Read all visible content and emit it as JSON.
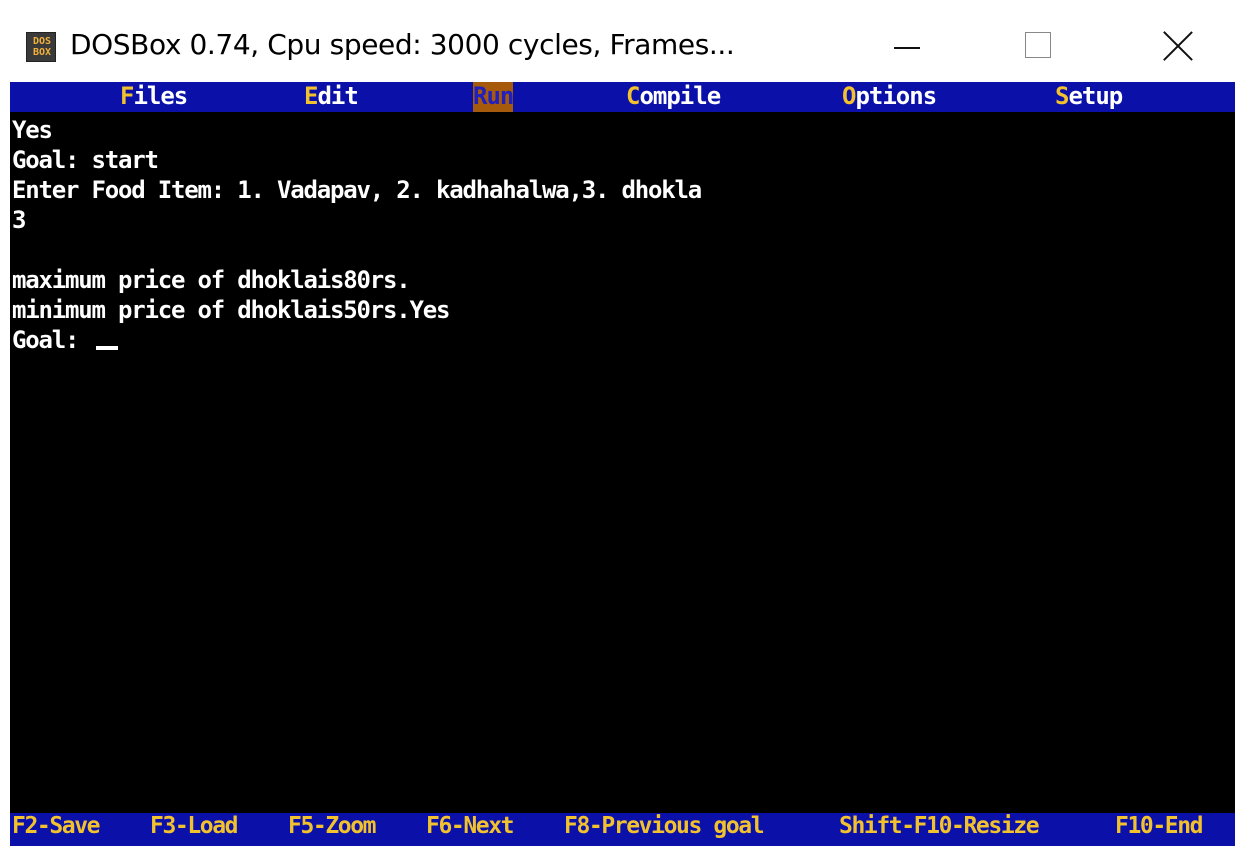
{
  "window": {
    "title": "DOSBox 0.74, Cpu speed:     3000 cycles, Frames...",
    "icon_top": "DOS",
    "icon_bottom": "BOX",
    "icon": "dosbox-icon",
    "controls": [
      "minimize-icon",
      "maximize-icon",
      "close-icon"
    ]
  },
  "menu": {
    "items": [
      {
        "hot": "F",
        "rest": "iles"
      },
      {
        "hot": "E",
        "rest": "dit"
      },
      {
        "hot": "",
        "rest": "Run"
      },
      {
        "hot": "C",
        "rest": "ompile"
      },
      {
        "hot": "O",
        "rest": "ptions"
      },
      {
        "hot": "S",
        "rest": "etup"
      }
    ],
    "active": "Run"
  },
  "console": {
    "lines": [
      "Yes",
      "Goal: start",
      "Enter Food Item: 1. Vadapav, 2. kadhahalwa,3. dhokla",
      "3",
      "",
      "maximum price of dhoklais80rs.",
      "minimum price of dhoklais50rs.Yes",
      "Goal: "
    ]
  },
  "status": {
    "items": [
      "F2-Save",
      "F3-Load",
      "F5-Zoom",
      "F6-Next",
      "F8-Previous goal",
      "Shift-F10-Resize",
      "F10-End"
    ]
  },
  "colors": {
    "menu_bg": "#0a10a8",
    "hotkey": "#f2c12e",
    "active_bg": "#a55a0c",
    "screen_bg": "#000000",
    "text": "#ffffff"
  }
}
